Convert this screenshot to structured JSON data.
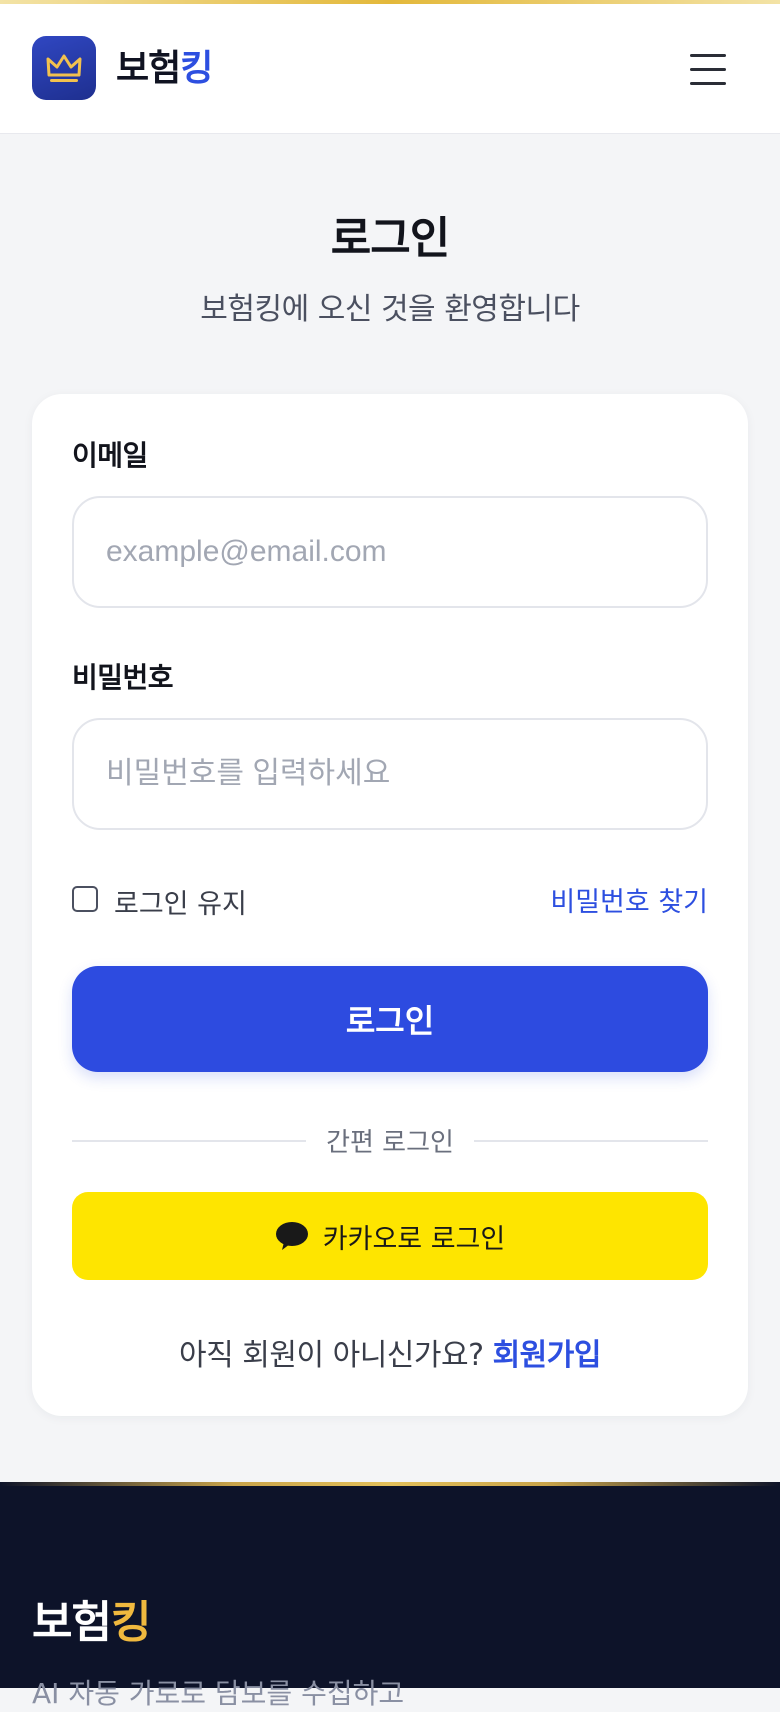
{
  "header": {
    "brand_main": "보험",
    "brand_accent": "킹"
  },
  "page": {
    "title": "로그인",
    "subtitle": "보험킹에 오신 것을 환영합니다"
  },
  "form": {
    "email_label": "이메일",
    "email_placeholder": "example@email.com",
    "email_value": "",
    "password_label": "비밀번호",
    "password_placeholder": "비밀번호를 입력하세요",
    "remember_label": "로그인 유지",
    "remember_checked": false,
    "find_password_label": "비밀번호 찾기",
    "login_button_label": "로그인",
    "divider_text": "간편 로그인",
    "kakao_button_label": "카카오로 로그인",
    "signup_prompt": "아직 회원이 아니신가요?",
    "signup_link_label": "회원가입"
  },
  "footer": {
    "brand_main": "보험",
    "brand_accent": "킹",
    "tagline": "AI 자동 가로로 담보를 수집하고"
  },
  "colors": {
    "primary": "#2d4be0",
    "kakao": "#fee500",
    "gold": "#f0b93e",
    "footer_bg": "#0d1329"
  }
}
